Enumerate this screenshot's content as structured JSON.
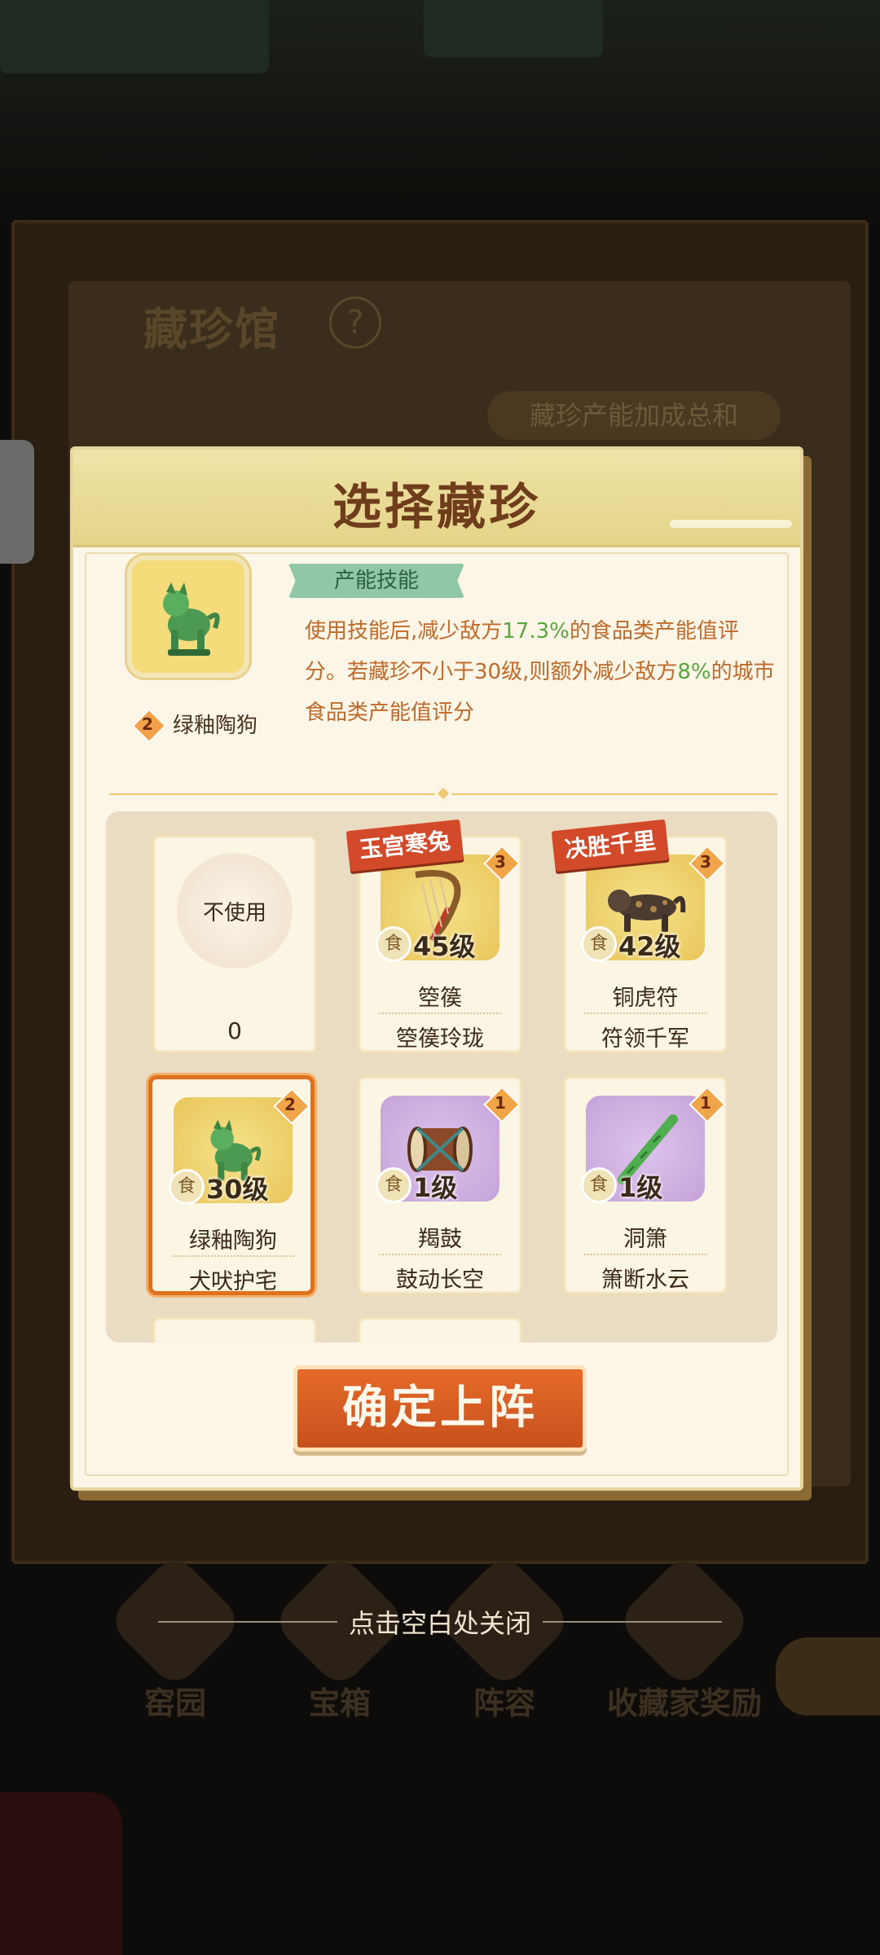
{
  "background": {
    "title": "藏珍馆",
    "help_icon": "question-icon",
    "bonus_label": "藏珍产能加成总和",
    "nav": [
      {
        "label": "窑园",
        "icon": "kiln-icon"
      },
      {
        "label": "宝箱",
        "icon": "chest-icon"
      },
      {
        "label": "阵容",
        "icon": "lineup-icon"
      },
      {
        "label": "收藏家奖励",
        "icon": "collector-icon"
      }
    ]
  },
  "modal": {
    "title": "选择藏珍",
    "skill": {
      "tag": "产能技能",
      "desc_1": "使用技能后,减少敌方",
      "desc_val_1": "17.3%",
      "desc_2": "的食品类产能值评分。若藏珍不小于30级,则额外减少敌方",
      "desc_val_2": "8%",
      "desc_3": "的城市食品类产能值评分",
      "star": "2",
      "name": "绿釉陶狗",
      "icon": "green-glazed-dog-icon"
    },
    "items": [
      {
        "type": "none",
        "label": "不使用",
        "count": "0"
      },
      {
        "ribbon": "玉宫寒兔",
        "star": "3",
        "level": "45级",
        "name": "箜篌",
        "skill": "箜篌玲珑",
        "thumb": "gold",
        "icon": "harp-icon",
        "food": "食"
      },
      {
        "ribbon": "决胜千里",
        "star": "3",
        "level": "42级",
        "name": "铜虎符",
        "skill": "符领千军",
        "thumb": "gold",
        "icon": "bronze-tiger-icon",
        "food": "食"
      },
      {
        "star": "2",
        "level": "30级",
        "name": "绿釉陶狗",
        "skill": "犬吠护宅",
        "thumb": "gold",
        "icon": "green-glazed-dog-icon",
        "food": "食",
        "selected": true
      },
      {
        "star": "1",
        "level": "1级",
        "name": "羯鼓",
        "skill": "鼓动长空",
        "thumb": "purple",
        "icon": "drum-icon",
        "food": "食"
      },
      {
        "star": "1",
        "level": "1级",
        "name": "洞箫",
        "skill": "箫断水云",
        "thumb": "purple",
        "icon": "flute-icon",
        "food": "食"
      }
    ],
    "confirm_label": "确定上阵"
  },
  "close_hint": "点击空白处关闭",
  "colors": {
    "accent_orange": "#e0711f",
    "highlight_green": "#58a83c",
    "ribbon_red": "#d24a2a",
    "title_brown": "#6f3d1c"
  }
}
